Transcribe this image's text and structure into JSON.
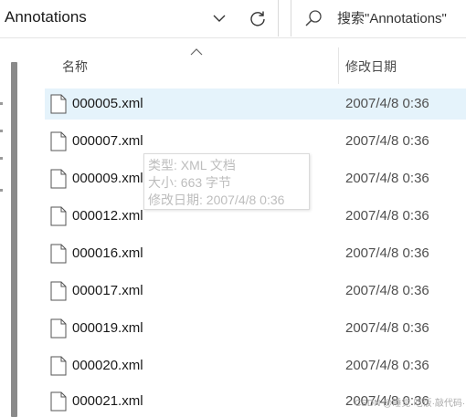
{
  "address_bar": {
    "path": "Annotations"
  },
  "search": {
    "placeholder": "搜索\"Annotations\""
  },
  "columns": {
    "name_label": "名称",
    "date_label": "修改日期"
  },
  "files": [
    {
      "name": "000005.xml",
      "modified": "2007/4/8 0:36",
      "selected": true
    },
    {
      "name": "000007.xml",
      "modified": "2007/4/8 0:36",
      "selected": false
    },
    {
      "name": "000009.xml",
      "modified": "2007/4/8 0:36",
      "selected": false
    },
    {
      "name": "000012.xml",
      "modified": "2007/4/8 0:36",
      "selected": false
    },
    {
      "name": "000016.xml",
      "modified": "2007/4/8 0:36",
      "selected": false
    },
    {
      "name": "000017.xml",
      "modified": "2007/4/8 0:36",
      "selected": false
    },
    {
      "name": "000019.xml",
      "modified": "2007/4/8 0:36",
      "selected": false
    },
    {
      "name": "000020.xml",
      "modified": "2007/4/8 0:36",
      "selected": false
    },
    {
      "name": "000021.xml",
      "modified": "2007/4/8 0:36",
      "selected": false
    }
  ],
  "tooltip": {
    "type_line": "类型: XML 文档",
    "size_line": "大小: 663 字节",
    "modified_line": "修改日期: 2007/4/8 0:36"
  },
  "watermark": {
    "text": "CSDN @睡觉·吃饭·敲代码·东西"
  },
  "icons": {
    "dropdown": "chevron-down-icon",
    "refresh": "refresh-icon",
    "search": "search-icon",
    "file": "document-icon",
    "sort": "sort-up-icon"
  },
  "colors": {
    "selection": "#e5f3fb",
    "scrollbar": "#8a8a8a",
    "header_text": "#4a4a4a",
    "tooltip_text": "#bdbdbd"
  }
}
